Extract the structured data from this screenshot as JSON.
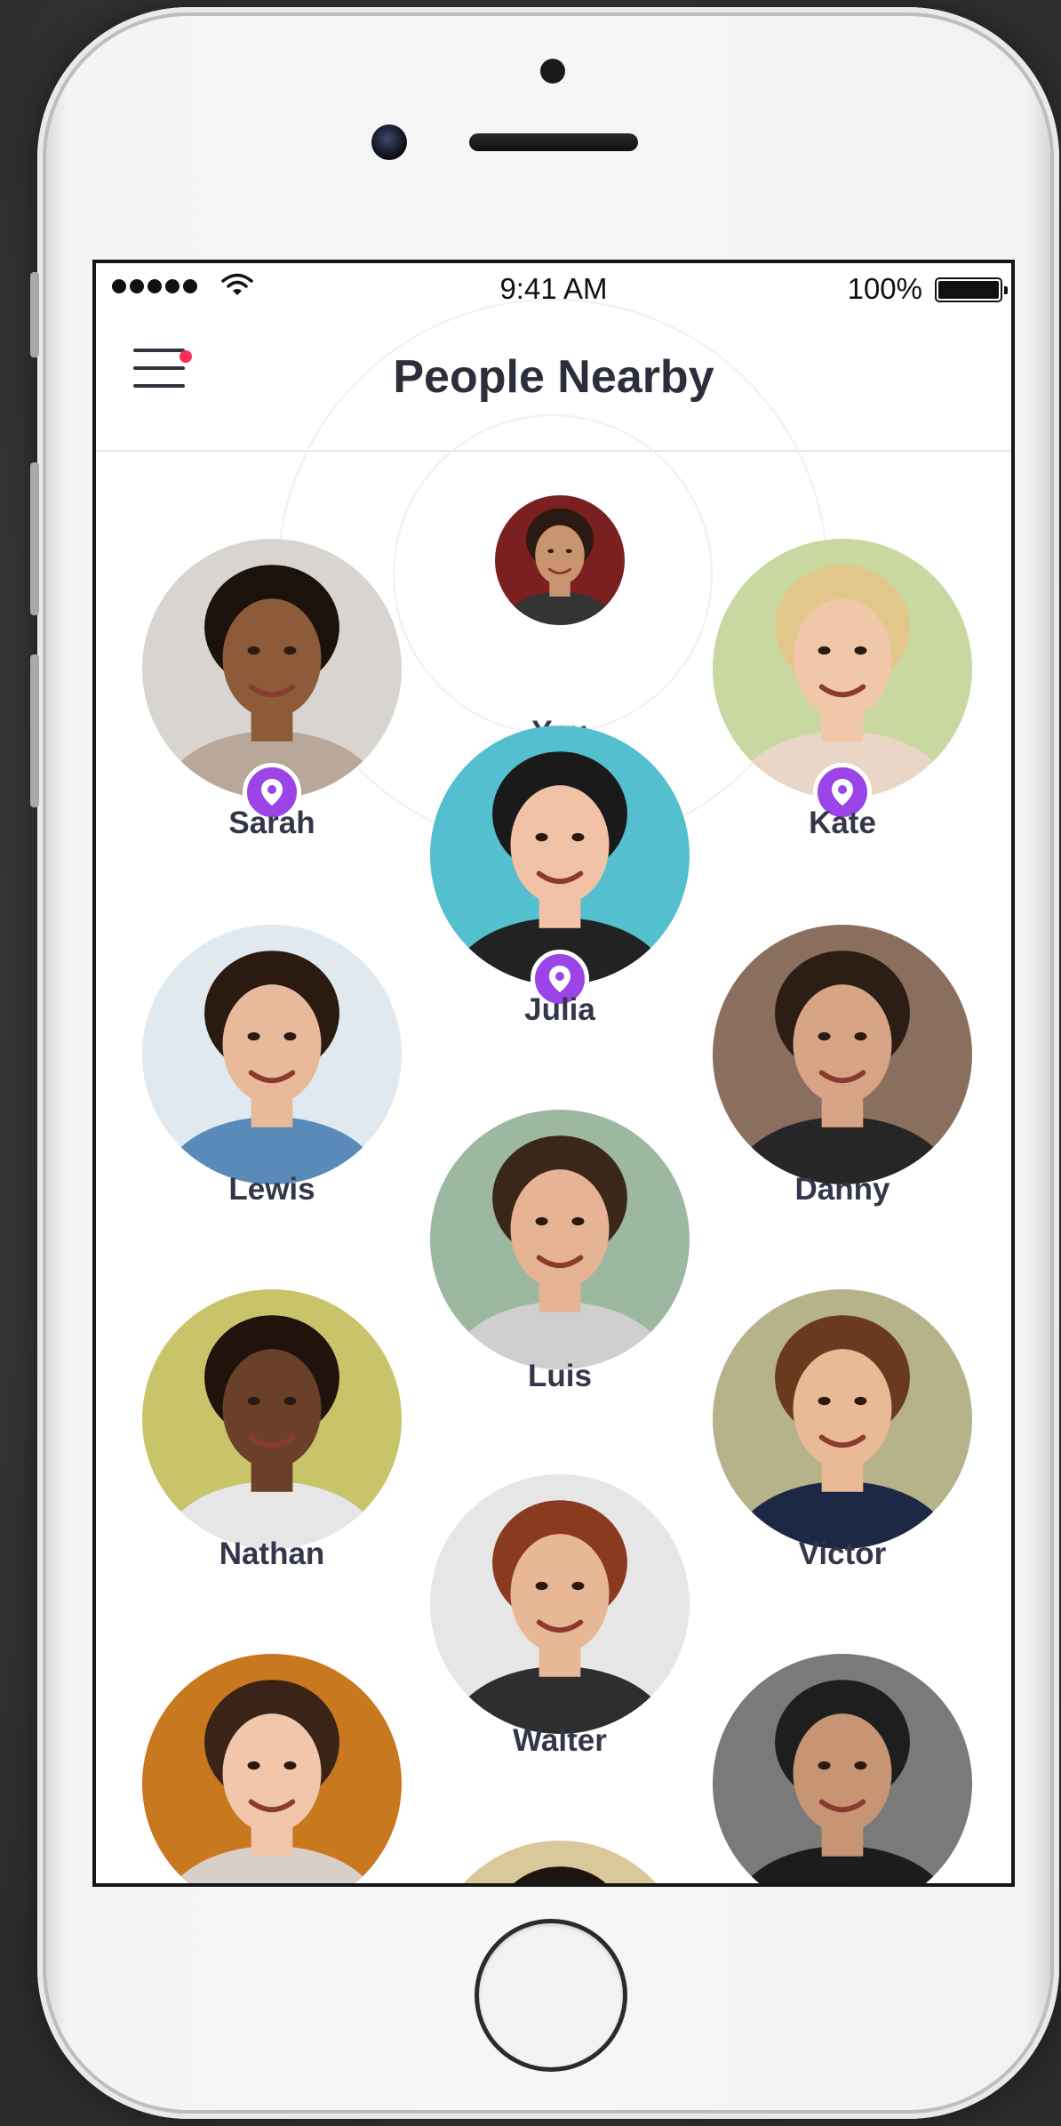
{
  "status_bar": {
    "time": "9:41 AM",
    "battery": "100%"
  },
  "nav": {
    "title": "People Nearby",
    "menu_icon": "menu-icon",
    "notification_color": "#ff2d55"
  },
  "accent_color": "#9b44e8",
  "people": [
    {
      "name": "You",
      "skin": "#c9956f",
      "hair": "#2a1a12",
      "shirt": "#333333",
      "bg": "#7a2020",
      "location_pin": false
    },
    {
      "name": "Sarah",
      "skin": "#8d5a3a",
      "hair": "#1c120c",
      "shirt": "#b9a89a",
      "bg": "#d8d4d0",
      "location_pin": true
    },
    {
      "name": "Kate",
      "skin": "#f0c7a8",
      "hair": "#e2c68a",
      "shirt": "#e9d6c6",
      "bg": "#c8d8a0",
      "location_pin": true
    },
    {
      "name": "Julia",
      "skin": "#f2c2a6",
      "hair": "#1a1a1a",
      "shirt": "#222222",
      "bg": "#54bfcf",
      "location_pin": true
    },
    {
      "name": "Lewis",
      "skin": "#e8b99a",
      "hair": "#2a1a10",
      "shirt": "#5a8ab8",
      "bg": "#dfe9ef",
      "location_pin": false
    },
    {
      "name": "Danny",
      "skin": "#d7a485",
      "hair": "#2c1e15",
      "shirt": "#262626",
      "bg": "#8a6e5e",
      "location_pin": false
    },
    {
      "name": "Luis",
      "skin": "#e6b495",
      "hair": "#3b2718",
      "shirt": "#cfcfcf",
      "bg": "#9db8a0",
      "location_pin": false
    },
    {
      "name": "Nathan",
      "skin": "#6a4028",
      "hair": "#1f130c",
      "shirt": "#e6e6e6",
      "bg": "#c9c36a",
      "location_pin": false
    },
    {
      "name": "Victor",
      "skin": "#eab995",
      "hair": "#6a3a1e",
      "shirt": "#1c2844",
      "bg": "#b6b28a",
      "location_pin": false
    },
    {
      "name": "Walter",
      "skin": "#e8b896",
      "hair": "#8a3a1e",
      "shirt": "#2e2e2e",
      "bg": "#e6e6e6",
      "location_pin": false
    },
    {
      "name": "",
      "skin": "#f2c6aa",
      "hair": "#3a2418",
      "shirt": "#d8d0c8",
      "bg": "#c8781e",
      "location_pin": false
    },
    {
      "name": "",
      "skin": "#c79474",
      "hair": "#1e1e1e",
      "shirt": "#1c1c1c",
      "bg": "#7a7a7a",
      "location_pin": false
    },
    {
      "name": "",
      "skin": "#e0b090",
      "hair": "#1e1410",
      "shirt": "#333333",
      "bg": "#d8c89a",
      "location_pin": false
    }
  ]
}
